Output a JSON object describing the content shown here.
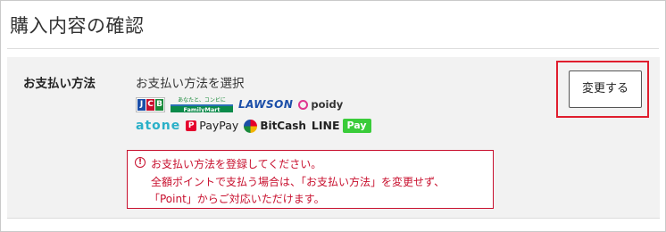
{
  "page": {
    "title": "購入内容の確認"
  },
  "payment": {
    "row_label": "お支払い方法",
    "section_heading": "お支払い方法を選択",
    "logos": {
      "jcb": [
        "J",
        "C",
        "B"
      ],
      "familymart_top": "あなたと、コンビに",
      "familymart_bottom": "FamilyMart",
      "lawson": "LAWSON",
      "poidy": "poidy",
      "atone": "atone",
      "paypay": "PayPay",
      "bitcash": "BitCash",
      "linepay_line": "LINE",
      "linepay_pay": "Pay"
    },
    "error": {
      "icon": "!",
      "line1": "お支払い方法を登録してください。",
      "line2": "全額ポイントで支払う場合は、「お支払い方法」を変更せず、",
      "line3": "「Point」からご対応いただけます。"
    },
    "change_button_label": "変更する"
  }
}
